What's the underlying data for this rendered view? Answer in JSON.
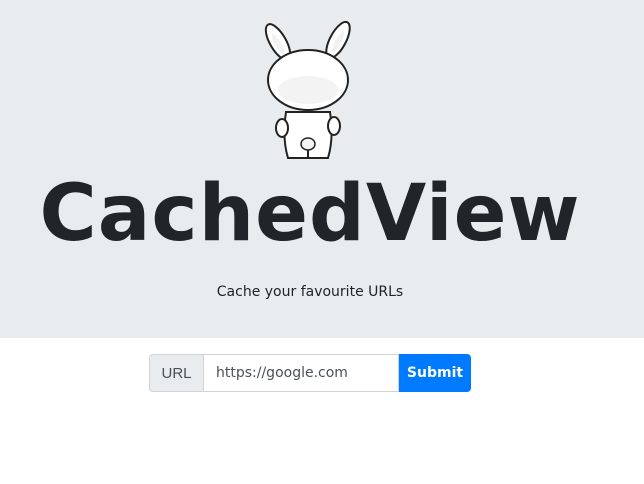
{
  "hero": {
    "mascot_icon": "bunny-mascot-icon",
    "title": "CachedView",
    "tagline": "Cache your favourite URLs"
  },
  "form": {
    "prepend_label": "URL",
    "input_placeholder": "https://google.com",
    "input_value": "",
    "submit_label": "Submit"
  },
  "colors": {
    "hero_background": "#e9ecef",
    "primary": "#007bff",
    "text": "#212529"
  }
}
